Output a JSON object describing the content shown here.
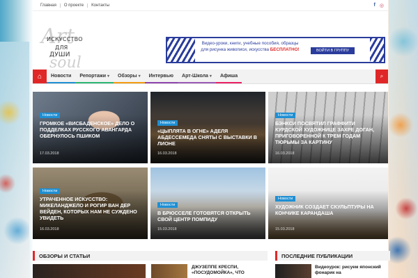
{
  "topbar": {
    "links": [
      "Главная",
      "О проекте",
      "Контакты"
    ],
    "social": {
      "facebook": "f",
      "instagram": "◎"
    }
  },
  "logo": {
    "script_top": "Art",
    "line1": "ИСКУССТВО",
    "line2": "ДЛЯ",
    "line3": "ДУШИ",
    "script_bottom": "soul"
  },
  "banner": {
    "text": "Видео-уроки, книги, учебные пособия, образцы для рисунка живописи, искусства",
    "highlight": "БЕСПЛАТНО!",
    "cta": "ВОЙТИ В ГРУППУ"
  },
  "nav": {
    "home_icon": "⌂",
    "items": [
      "Новости",
      "Репортажи",
      "Обзоры",
      "Интервью",
      "Арт-Школа",
      "Афиша"
    ],
    "search_icon": "⌕"
  },
  "cards": [
    {
      "tag": "Новости",
      "title": "Громкое «висбаденское» дело о подделках русского авангарда обернулось пшиком",
      "date": "17.03.2018"
    },
    {
      "tag": "Новости",
      "title": "«Цыплята в огне» Аделя Абдессемеда сняты с выставки в Лионе",
      "date": "16.03.2018"
    },
    {
      "tag": "Новости",
      "title": "Бэнкси посвятил граффити курдской художнице Захре Доган, приговоренной к трем годам тюрьмы за картину",
      "date": "16.03.2018"
    },
    {
      "tag": "Новости",
      "title": "Утраченное искусство: Микеланджело и Рогир ван дер Вейден, которых нам не суждено увидеть",
      "date": "16.03.2018"
    },
    {
      "tag": "Новости",
      "title": "В Брюсселе готовятся открыть свой центр Помпиду",
      "date": "15.03.2018"
    },
    {
      "tag": "Новости",
      "title": "Художник создает скульптуры на кончике карандаша",
      "date": "15.03.2018"
    }
  ],
  "sections": {
    "left_title": "ОБЗОРЫ И СТАТЬИ",
    "right_title": "ПОСЛЕДНИЕ ПУБЛИКАЦИИ"
  },
  "bottom": {
    "article1": "ДЖУЗЕППЕ КРЕСПИ, «ПОСУДОМОЙКА», ЧТО",
    "article2": "Видеоурок: рисуем японский фонарик на"
  }
}
